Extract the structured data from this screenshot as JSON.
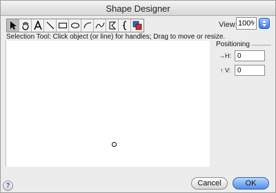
{
  "window": {
    "title": "Shape Designer"
  },
  "toolbar": {
    "tools": [
      {
        "name": "arrow-tool",
        "icon": "arrow-icon",
        "selected": true
      },
      {
        "name": "hand-tool",
        "icon": "hand-icon"
      },
      {
        "name": "text-tool",
        "icon": "text-a-icon"
      },
      {
        "name": "line-tool",
        "icon": "line-icon"
      },
      {
        "name": "rectangle-tool",
        "icon": "rectangle-icon"
      },
      {
        "name": "oval-tool",
        "icon": "oval-icon"
      },
      {
        "name": "arc-tool",
        "icon": "arc-icon"
      },
      {
        "name": "curve-tool",
        "icon": "curve-icon"
      },
      {
        "name": "polygon-tool",
        "icon": "polygon-icon"
      },
      {
        "name": "brace-tool",
        "icon": "brace-icon"
      },
      {
        "name": "color-tool",
        "icon": "color-icon"
      }
    ]
  },
  "view": {
    "label": "View:",
    "value": "100%"
  },
  "hint": "Selection Tool: Click object (or line) for handles; Drag to move or resize.",
  "positioning": {
    "title": "Positioning",
    "h_label": "H:",
    "v_label": "V:",
    "h_value": "0",
    "v_value": "0"
  },
  "buttons": {
    "cancel": "Cancel",
    "ok": "OK",
    "help": "?"
  }
}
